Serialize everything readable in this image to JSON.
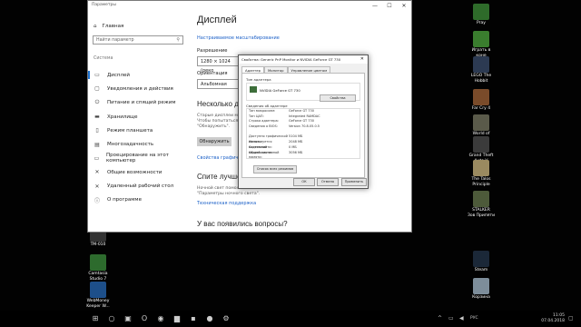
{
  "settings": {
    "window_title": "Параметры",
    "controls": [
      "—",
      "☐",
      "✕"
    ],
    "home_label": "Главная",
    "search_placeholder": "Найти параметр",
    "section_label": "Система",
    "nav": [
      {
        "icon": "display-icon",
        "glyph": "▭",
        "label": "Дисплей"
      },
      {
        "icon": "notifications-icon",
        "glyph": "▢",
        "label": "Уведомления и действия"
      },
      {
        "icon": "power-icon",
        "glyph": "⏻",
        "label": "Питание и спящий режим"
      },
      {
        "icon": "storage-icon",
        "glyph": "▬",
        "label": "Хранилище"
      },
      {
        "icon": "tablet-icon",
        "glyph": "▯",
        "label": "Режим планшета"
      },
      {
        "icon": "multitasking-icon",
        "glyph": "▤",
        "label": "Многозадачность"
      },
      {
        "icon": "projecting-icon",
        "glyph": "▭",
        "label": "Проецирование на этот компьютер"
      },
      {
        "icon": "shared-experiences-icon",
        "glyph": "✕",
        "label": "Общие возможности"
      },
      {
        "icon": "remote-desktop-icon",
        "glyph": "✕",
        "label": "Удаленный рабочий стол"
      },
      {
        "icon": "about-icon",
        "glyph": "ⓘ",
        "label": "О программе"
      }
    ],
    "content": {
      "title": "Дисплей",
      "scale_link": "Настраиваемое масштабирование",
      "resolution_label": "Разрешение",
      "resolution_value": "1280 × 1024 (реко",
      "orientation_label": "Ориентация",
      "orientation_value": "Альбомная",
      "multi_heading": "Несколько ди",
      "multi_text": "Старые дисплеи мог\nЧтобы попытаться\n\"Обнаружить\".",
      "detect_button": "Обнаружить",
      "graphics_link": "Свойства графиче",
      "sleep_heading": "Спите лучше",
      "sleep_text": "Ночной свет поможе\n\"Параметры ночного света\".",
      "tech_link": "Техническая поддержка",
      "questions_heading": "У вас появились вопросы?"
    }
  },
  "dialog": {
    "title": "Свойства: Generic PnP Monitor и NVIDIA GeForce GT 730",
    "tabs": [
      "Адаптер",
      "Монитор",
      "Управление цветом"
    ],
    "adapter_group": "Тип адаптера",
    "adapter_name": "NVIDIA GeForce GT 730",
    "properties_button": "Свойства",
    "info_group": "Сведения об адаптере",
    "info_rows": [
      {
        "k": "Тип микросхем:",
        "v": "GeForce GT 730"
      },
      {
        "k": "Тип ЦАП:",
        "v": "Integrated RAMDAC"
      },
      {
        "k": "Строка адаптера:",
        "v": "GeForce GT 730"
      },
      {
        "k": "Сведения о BIOS:",
        "v": "Version 70.8.05.0.5"
      },
      {
        "k": "",
        "v": ""
      },
      {
        "k": "Доступно графической памяти:",
        "v": "5104 МБ"
      },
      {
        "k": "Используется видеопамяти:",
        "v": "2048 МБ"
      },
      {
        "k": "Системной видеопамяти:",
        "v": "0 МБ"
      },
      {
        "k": "Общей системной памяти:",
        "v": "3056 МБ"
      }
    ],
    "modes_button": "Список всех режимов",
    "ok": "ОК",
    "cancel": "Отмена",
    "apply": "Применить"
  },
  "desktop_icons": [
    {
      "name": "pray-shortcut-icon",
      "label": "Pray",
      "color": "#2e6b2a"
    },
    {
      "name": "game-shortcut-icon",
      "label": "Играть в\nконе",
      "color": "#3a7d2e"
    },
    {
      "name": "lego-hobbit-shortcut-icon",
      "label": "LEGO The\nHobbit",
      "color": "#2c3a52"
    },
    {
      "name": "far-cry-4-shortcut-icon",
      "label": "Far Cry 4",
      "color": "#7a4b2a"
    },
    {
      "name": "world-of-tanks-shortcut-icon",
      "label": "World of\nTanks",
      "color": "#5a5a4a"
    },
    {
      "name": "gta-v-shortcut-icon",
      "label": "Grand Theft\nAuto V",
      "color": "#3b3b3b"
    },
    {
      "name": "talos-principle-shortcut-icon",
      "label": "The Talos\nPrinciple",
      "color": "#9a8a60"
    },
    {
      "name": "stalker-shortcut-icon",
      "label": "STALKER\nЗов Припяти",
      "color": "#4d5a3a"
    },
    {
      "name": "steam-shortcut-icon",
      "label": "Steam",
      "color": "#1b2838"
    },
    {
      "name": "recycle-bin-icon",
      "label": "Корзина",
      "color": "#7d8d9a"
    },
    {
      "name": "tm-shortcut-icon",
      "label": "TM-010",
      "color": "#333333"
    },
    {
      "name": "camtasia-shortcut-icon",
      "label": "Camtasia\nStudio 7",
      "color": "#2d6b2d"
    },
    {
      "name": "webmoney-shortcut-icon",
      "label": "WebMoney\nKeeper W...",
      "color": "#1d4f8a"
    }
  ],
  "taskbar": {
    "icons": [
      {
        "name": "start-icon",
        "glyph": "⊞"
      },
      {
        "name": "search-icon",
        "glyph": "○"
      },
      {
        "name": "task-view-icon",
        "glyph": "▣"
      },
      {
        "name": "opera-icon",
        "glyph": "O"
      },
      {
        "name": "chrome-icon",
        "glyph": "◉"
      },
      {
        "name": "explorer-icon",
        "glyph": "▆"
      },
      {
        "name": "store-icon",
        "glyph": "▪"
      },
      {
        "name": "camera-icon",
        "glyph": "●"
      },
      {
        "name": "settings-icon",
        "glyph": "⚙"
      }
    ],
    "language": "РУС",
    "time": "11:05",
    "date": "07.04.2018"
  }
}
